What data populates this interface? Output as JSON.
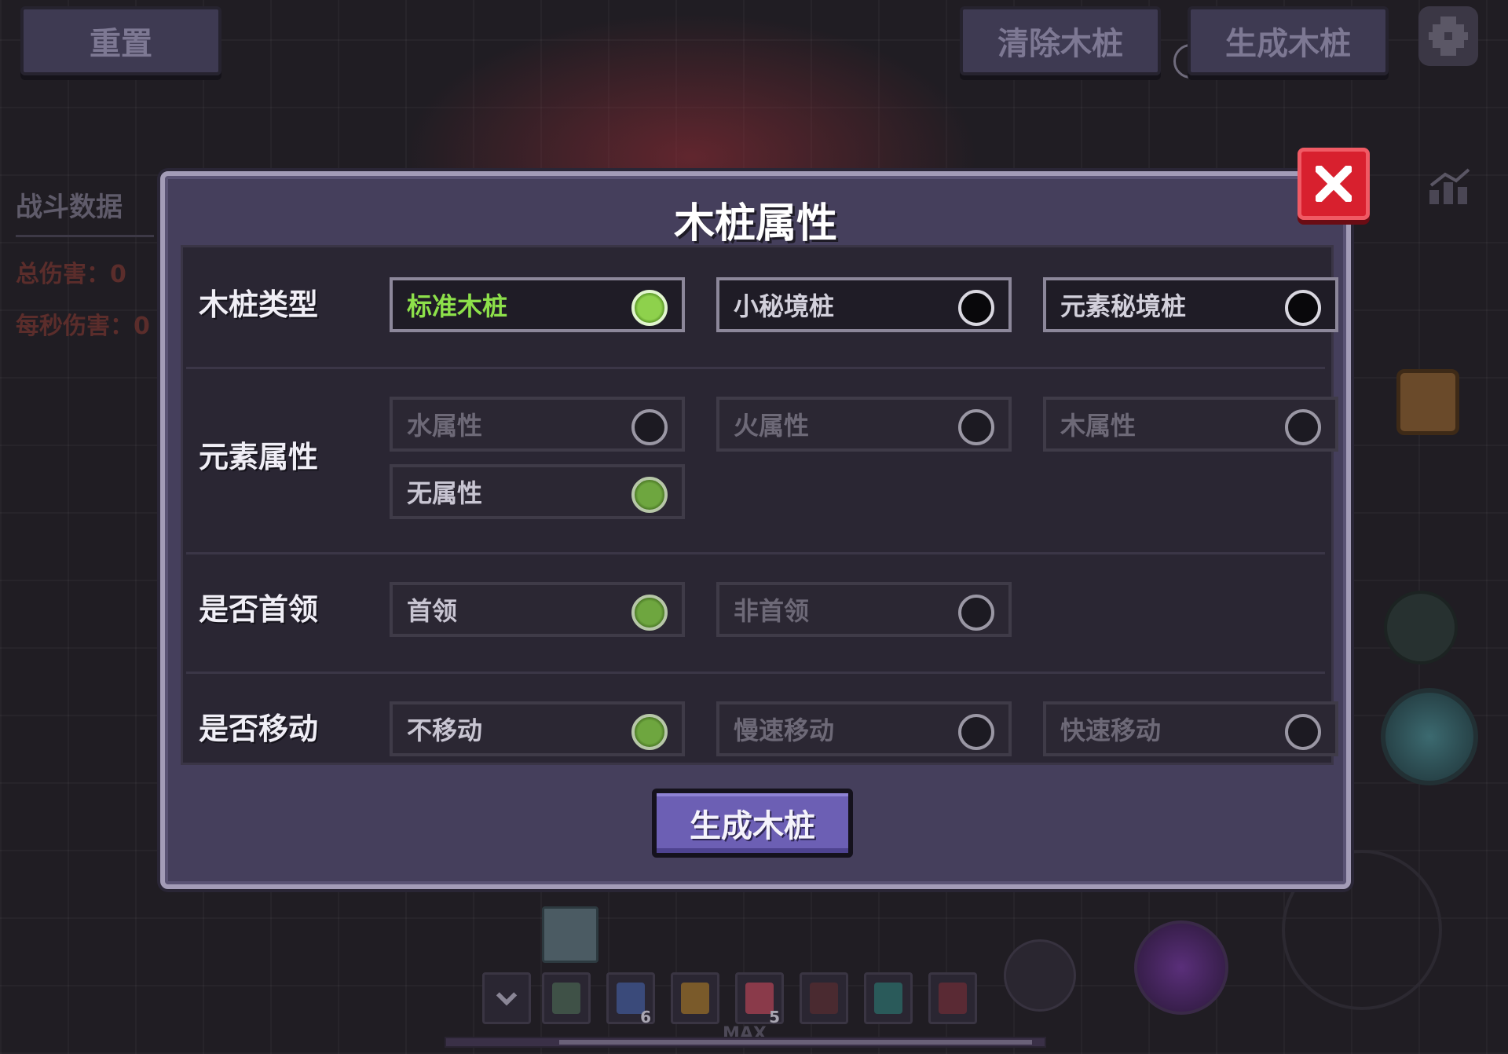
{
  "hud": {
    "reset_label": "重置",
    "clear_label": "清除木桩",
    "spawn_label": "生成木桩"
  },
  "battle": {
    "title": "战斗数据",
    "total_damage": "总伤害：0",
    "dps": "每秒伤害：0"
  },
  "dialog": {
    "title": "木桩属性",
    "spawn_button": "生成木桩",
    "rows": {
      "stake_type": {
        "label": "木桩类型",
        "options": [
          "标准木桩",
          "小秘境桩",
          "元素秘境桩"
        ],
        "selected": "标准木桩"
      },
      "element": {
        "label": "元素属性",
        "options": [
          "水属性",
          "火属性",
          "木属性",
          "无属性"
        ],
        "selected": "无属性"
      },
      "boss": {
        "label": "是否首领",
        "options": [
          "首领",
          "非首领"
        ],
        "selected": "首领"
      },
      "move": {
        "label": "是否移动",
        "options": [
          "不移动",
          "慢速移动",
          "快速移动"
        ],
        "selected": "不移动"
      }
    }
  },
  "hotbar": {
    "slot_counts": [
      "6",
      "5"
    ],
    "max_label": "MAX",
    "xp_fraction": 0.79
  },
  "colors": {
    "accent_green": "#8de04a",
    "close_red": "#d8202e",
    "dialog_bg": "#453f5c",
    "spawn_button": "#6c5fb4"
  }
}
